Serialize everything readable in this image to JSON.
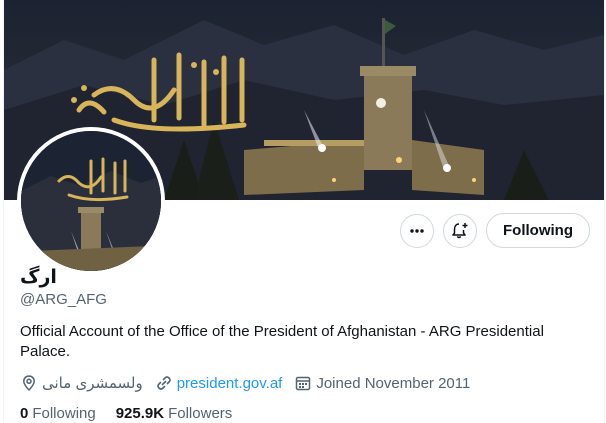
{
  "profile": {
    "name": "ارگ",
    "handle": "@ARG_AFG",
    "bio": "Official Account of the Office of the President of Afghanistan - ARG Presidential Palace.",
    "location": "ولسمشری مانی",
    "website": "president.gov.af",
    "joined": "Joined November 2011",
    "following_count": "0",
    "following_label": "Following",
    "followers_count": "925.9K",
    "followers_label": "Followers"
  },
  "actions": {
    "more_icon": "more-horizontal-icon",
    "notify_icon": "bell-plus-icon",
    "follow_label": "Following"
  },
  "icons": {
    "location": "location-pin-icon",
    "link": "link-icon",
    "calendar": "calendar-icon"
  },
  "colors": {
    "link": "#1d9bf0",
    "muted": "#536471",
    "text": "#0f1419",
    "border": "#cfd9de",
    "calligraphy": "#d8b45a"
  }
}
